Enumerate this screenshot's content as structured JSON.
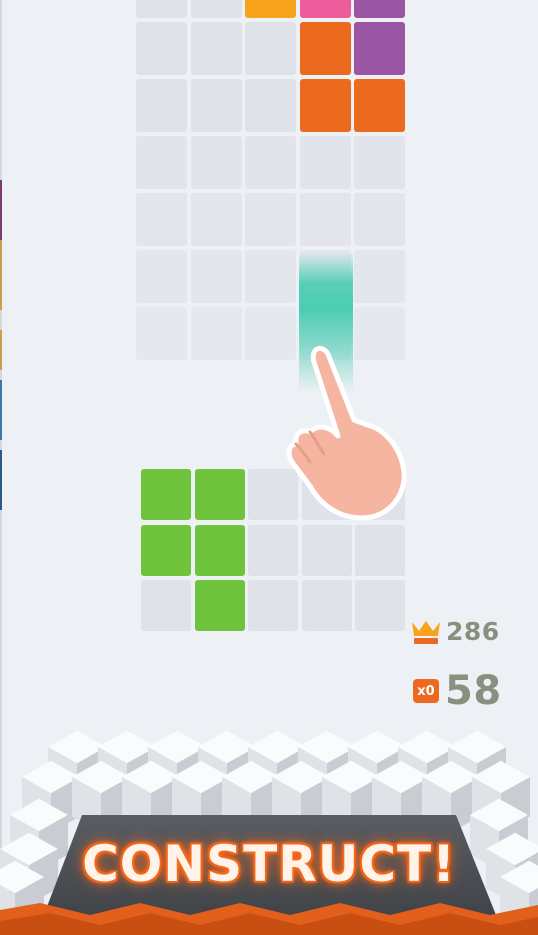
{
  "colors": {
    "empty_cell": "#dfe3e9",
    "orange": "#ec6a1f",
    "yellow_orange": "#f7a41c",
    "pink": "#ee5d9b",
    "purple": "#9a55a3",
    "green": "#70c33c",
    "teal_trail": "#4acdb2",
    "hand": "#f5b5a0",
    "score_text": "#8a8f80"
  },
  "top_grid": {
    "rows": [
      [
        "empty",
        "empty",
        "yellow_orange",
        "pink",
        "purple"
      ],
      [
        "empty",
        "empty",
        "empty",
        "orange",
        "purple"
      ],
      [
        "empty",
        "empty",
        "empty",
        "orange",
        "orange"
      ],
      [
        "empty",
        "empty",
        "empty",
        "empty",
        "empty"
      ],
      [
        "empty",
        "empty",
        "empty",
        "empty",
        "empty"
      ],
      [
        "empty",
        "empty",
        "empty",
        "empty",
        "empty"
      ],
      [
        "empty",
        "empty",
        "empty",
        "empty",
        "empty"
      ]
    ]
  },
  "bottom_grid": {
    "rows": [
      [
        "green",
        "green",
        "empty",
        "empty",
        "empty"
      ],
      [
        "green",
        "green",
        "empty",
        "empty",
        "empty"
      ],
      [
        "empty",
        "green",
        "empty",
        "empty",
        "empty"
      ]
    ]
  },
  "scores": {
    "best_icon": "crown-icon",
    "best": "286",
    "multiplier": "x0",
    "current": "58"
  },
  "banner": {
    "text": "CONSTRUCT!"
  }
}
